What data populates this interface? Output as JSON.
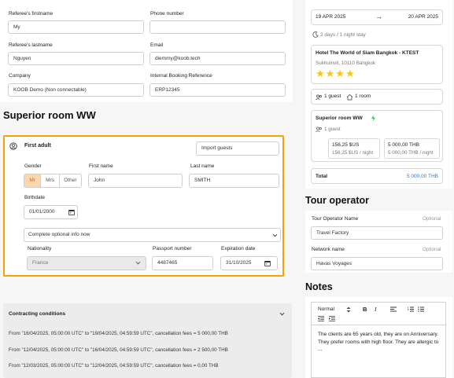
{
  "referee": {
    "firstname_label": "Referee's firstname",
    "firstname_value": "My",
    "phone_label": "Phone number",
    "phone_value": "",
    "lastname_label": "Referee's lastname",
    "lastname_value": "Nguyen",
    "email_label": "Email",
    "email_value": "diemmy@koob.tech",
    "company_label": "Company",
    "company_value": "KOOB Demo (Non connectable)",
    "ibr_label": "Internal Booking Reference",
    "ibr_value": "ERP12345"
  },
  "room": {
    "title": "Superior room WW",
    "adult_title": "First adult",
    "import_label": "Import guests",
    "gender_label": "Gender",
    "gender_options": [
      "Mr",
      "Mrs",
      "Other"
    ],
    "first_name_label": "First name",
    "first_name_value": "John",
    "last_name_label": "Last name",
    "last_name_value": "SMITH",
    "birthdate_label": "Birthdate",
    "birthdate_value": "01/01/2000",
    "optional_info_label": "Complete optional info now",
    "nationality_label": "Nationality",
    "nationality_value": "France",
    "passport_label": "Passport number",
    "passport_value": "4487465",
    "expiration_label": "Expiration date",
    "expiration_value": "31/10/2025"
  },
  "contracting": {
    "title": "Contracting conditions",
    "rows": [
      "From \"16/04/2025, 05:00:00 UTC\" to \"19/04/2025, 04:59:59 UTC\", cancellation fees = 5 000,00 THB",
      "From \"12/04/2025, 05:00:00 UTC\" to \"16/04/2025, 04:59:59 UTC\", cancellation fees = 2 500,00 THB",
      "From \"12/03/2025, 05:00:00 UTC\" to \"12/04/2025, 04:59:59 UTC\", cancellation fees = 0,00 THB"
    ]
  },
  "summary": {
    "date_from": "19 APR 2025",
    "arrow": "→",
    "date_to": "20 APR 2025",
    "stay": "2 days / 1 night stay",
    "hotel_name": "Hotel The World of Siam Bangkok - KTEST",
    "hotel_address": "Sukhumvit, 10110 Bangkok",
    "stars": "★★★★",
    "guests": "1 guest",
    "rooms": "1 room",
    "room_name": "Superior room WW",
    "room_guests": "1 guest",
    "price_usd": "156,25 $US",
    "price_usd_night": "156,25 $US / night",
    "price_thb": "5 000,00 THB",
    "price_thb_night": "5 000,00 THB / night",
    "total_label": "Total",
    "total_value": "5 000,00 THB",
    "star_color": "#f5c518",
    "accent": "#2b7bd6"
  },
  "tour_operator": {
    "title": "Tour operator",
    "name_label": "Tour Operator Name",
    "name_optional": "Optional",
    "name_value": "Travel Factory",
    "network_label": "Network name",
    "network_optional": "Optional",
    "network_value": "Havas Voyages"
  },
  "notes": {
    "title": "Notes",
    "format_label": "Normal",
    "text": "The clients are 65 years old, they are on Anniversary. They prefer rooms with high floor. They are allergic to ..."
  },
  "colors": {
    "highlight_border": "#f5a300",
    "gender_selected_bg": "#fbd7b0",
    "gender_selected_text": "#d2691e"
  }
}
